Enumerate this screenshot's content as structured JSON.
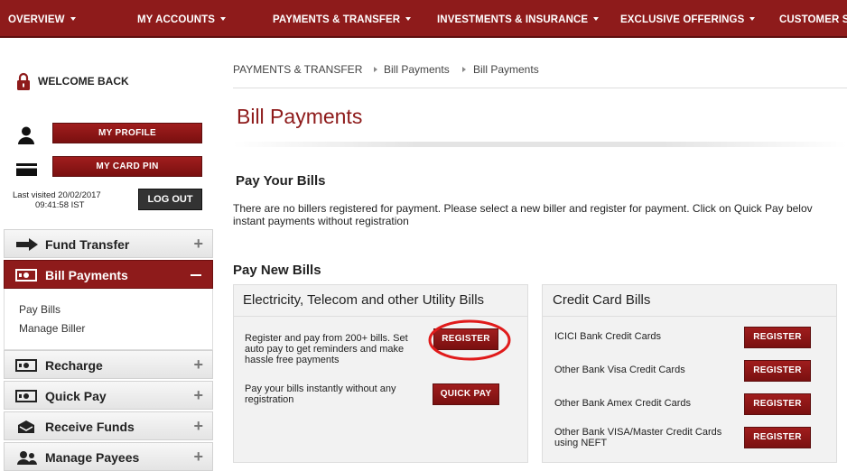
{
  "nav": {
    "items": [
      "OVERVIEW",
      "MY ACCOUNTS",
      "PAYMENTS & TRANSFER",
      "INVESTMENTS & INSURANCE",
      "EXCLUSIVE OFFERINGS",
      "CUSTOMER S"
    ]
  },
  "sidebar": {
    "welcome": "WELCOME BACK",
    "profile_button": "MY PROFILE",
    "card_pin_button": "MY CARD PIN",
    "last_visited": "Last visited 20/02/2017",
    "last_visited_time": "09:41:58 IST",
    "logout_button": "LOG OUT",
    "menu": [
      {
        "label": "Fund Transfer"
      },
      {
        "label": "Bill Payments"
      },
      {
        "label": "Recharge"
      },
      {
        "label": "Quick Pay"
      },
      {
        "label": "Receive Funds"
      },
      {
        "label": "Manage Payees"
      }
    ],
    "submenu": [
      "Pay Bills",
      "Manage Biller"
    ]
  },
  "breadcrumb": [
    "PAYMENTS & TRANSFER",
    "Bill Payments",
    "Bill Payments"
  ],
  "page_title": "Bill Payments",
  "pay_your_bills": {
    "heading": "Pay Your Bills",
    "message_line1": "There are no billers registered for payment. Please select a new biller and register for payment. Click on Quick Pay belov",
    "message_line2": "instant payments without registration"
  },
  "pay_new_bills": {
    "heading": "Pay New Bills",
    "utility": {
      "title": "Electricity, Telecom and other Utility Bills",
      "register_text_1": "Register and pay from 200+ bills. Set",
      "register_text_2": "auto pay to get reminders and make",
      "register_text_3": "hassle free payments",
      "register_button": "REGISTER",
      "quickpay_text_1": "Pay your bills instantly without any",
      "quickpay_text_2": "registration",
      "quickpay_button": "QUICK PAY"
    },
    "credit_card": {
      "title": "Credit Card Bills",
      "rows": [
        {
          "label": "ICICI Bank Credit Cards",
          "button": "REGISTER"
        },
        {
          "label": "Other Bank Visa Credit Cards",
          "button": "REGISTER"
        },
        {
          "label": "Other Bank Amex Credit Cards",
          "button": "REGISTER"
        },
        {
          "label": "Other Bank VISA/Master Credit Cards",
          "label2": "using NEFT",
          "button": "REGISTER"
        }
      ]
    }
  },
  "colors": {
    "brand": "#8e1b1b",
    "highlight_circle": "#e01b1b"
  }
}
